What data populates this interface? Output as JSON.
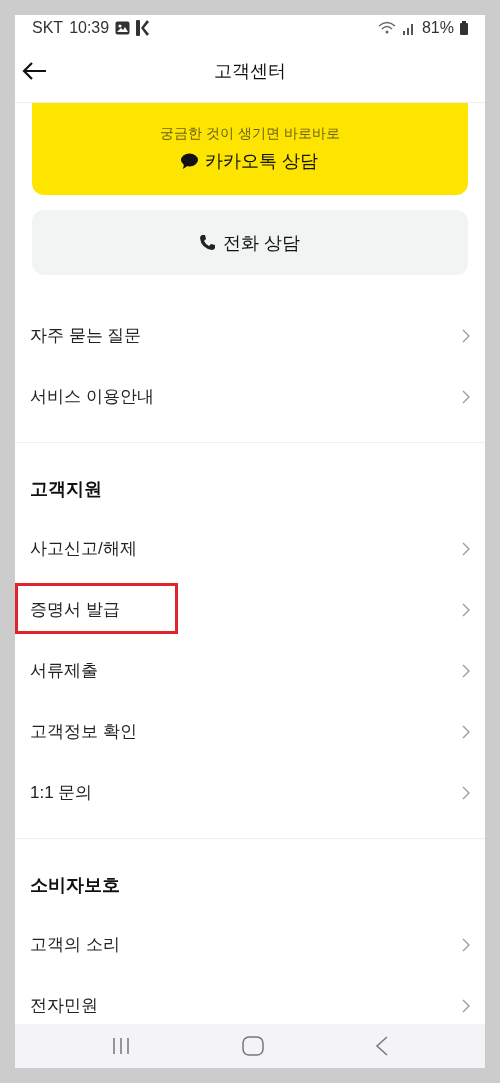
{
  "status_bar": {
    "carrier": "SKT",
    "time": "10:39",
    "battery": "81%"
  },
  "header": {
    "title": "고객센터"
  },
  "kakao_card": {
    "subtitle": "궁금한 것이 생기면 바로바로",
    "label": "카카오톡 상담"
  },
  "phone_card": {
    "label": "전화 상담"
  },
  "sections": [
    {
      "items": [
        {
          "label": "자주 묻는 질문",
          "highlighted": false
        },
        {
          "label": "서비스 이용안내",
          "highlighted": false
        }
      ]
    },
    {
      "title": "고객지원",
      "items": [
        {
          "label": "사고신고/해제",
          "highlighted": false
        },
        {
          "label": "증명서 발급",
          "highlighted": true
        },
        {
          "label": "서류제출",
          "highlighted": false
        },
        {
          "label": "고객정보 확인",
          "highlighted": false
        },
        {
          "label": "1:1 문의",
          "highlighted": false
        }
      ]
    },
    {
      "title": "소비자보호",
      "items": [
        {
          "label": "고객의 소리",
          "highlighted": false
        },
        {
          "label": "전자민원",
          "highlighted": false
        }
      ]
    }
  ]
}
